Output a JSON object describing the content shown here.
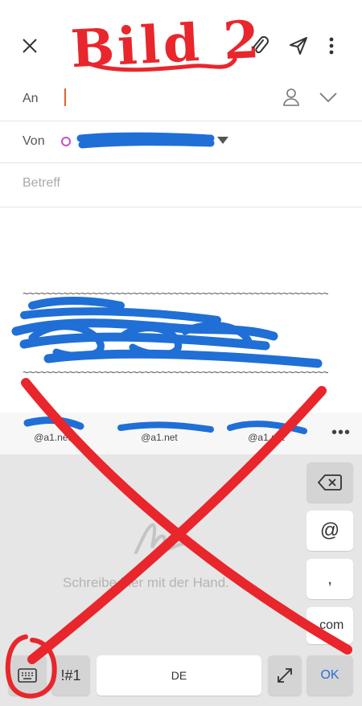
{
  "annotation": {
    "title": "Bild 2"
  },
  "header": {
    "close_icon": "close-icon",
    "attach_icon": "paperclip-icon",
    "send_icon": "send-icon",
    "more_icon": "more-vertical-icon"
  },
  "fields": {
    "to_label": "An",
    "from_label": "Von",
    "from_value": "",
    "subject_placeholder": "Betreff"
  },
  "suggestions": [
    {
      "domain": "@a1.net"
    },
    {
      "domain": "@a1.net"
    },
    {
      "domain": "@a1.net"
    }
  ],
  "keyboard": {
    "hint": "Schreibe hier mit der Hand.",
    "at": "@",
    "comma": ",",
    "dotcom": ".com",
    "symbols": "!#1",
    "space": "DE",
    "ok": "OK"
  },
  "colors": {
    "annotation_red": "#e8262c",
    "scribble_blue": "#1f6fd6",
    "accent_blue": "#2a6fd1",
    "cursor": "#e06030",
    "from_dot": "#c44fc6"
  }
}
